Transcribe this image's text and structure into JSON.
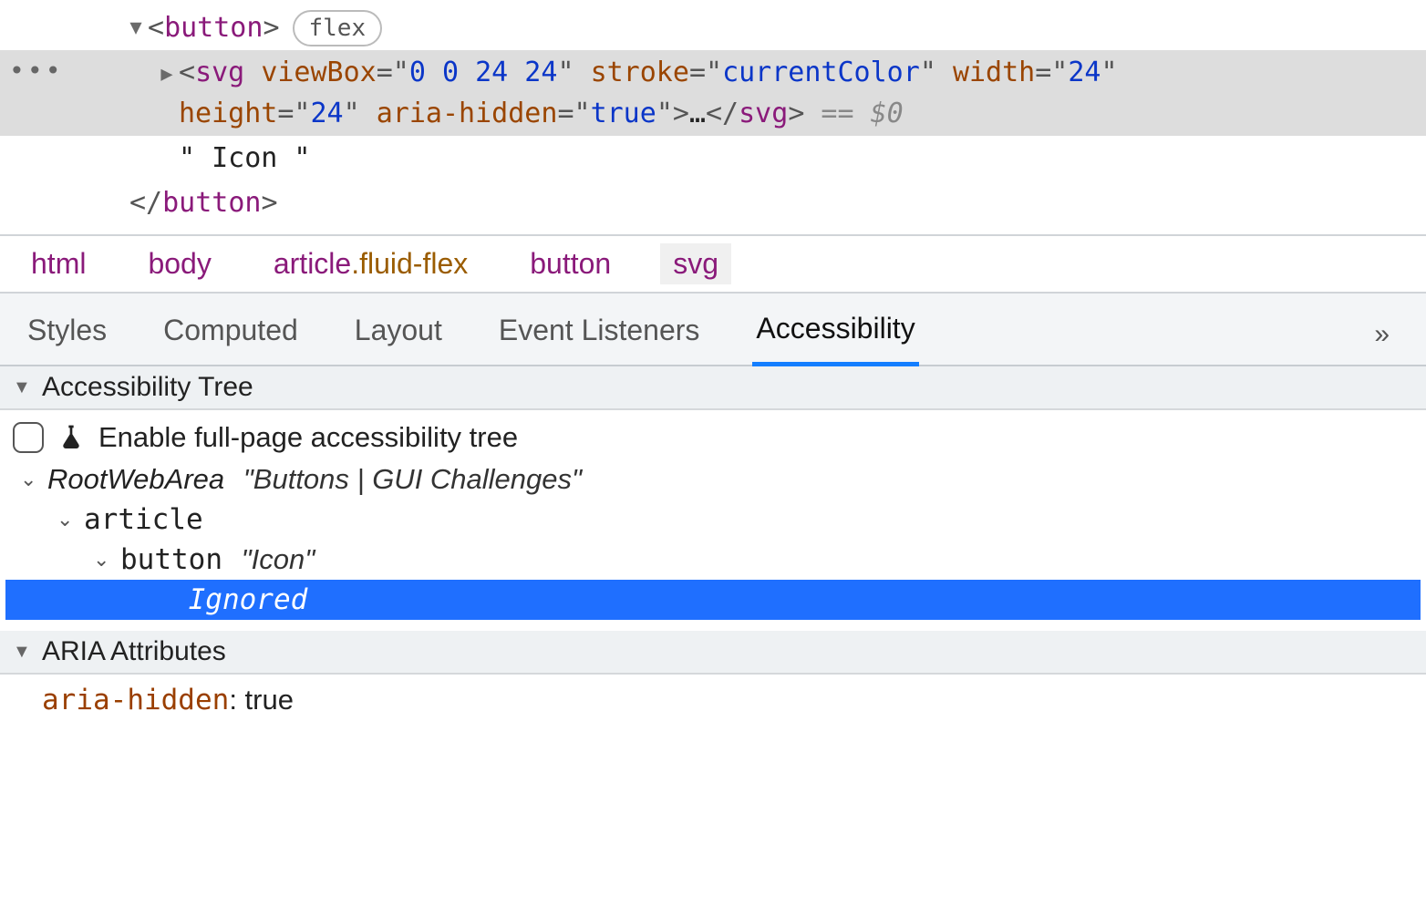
{
  "dom": {
    "button_open": "<button>",
    "button_close": "</button>",
    "flex_badge": "flex",
    "svg_tag": "svg",
    "svg_attrs": {
      "viewBox_name": "viewBox",
      "viewBox_val": "0 0 24 24",
      "stroke_name": "stroke",
      "stroke_val": "currentColor",
      "width_name": "width",
      "width_val": "24",
      "height_name": "height",
      "height_val": "24",
      "aria_hidden_name": "aria-hidden",
      "aria_hidden_val": "true"
    },
    "svg_collapsed_inner": "…",
    "selection_tail": " == $0",
    "text_node": "\" Icon \""
  },
  "breadcrumbs": {
    "html": "html",
    "body": "body",
    "article": "article",
    "article_class": ".fluid-flex",
    "button": "button",
    "svg": "svg"
  },
  "subtabs": {
    "styles": "Styles",
    "computed": "Computed",
    "layout": "Layout",
    "event_listeners": "Event Listeners",
    "accessibility": "Accessibility",
    "overflow": "»"
  },
  "a11y": {
    "section_tree": "Accessibility Tree",
    "enable_label": "Enable full-page accessibility tree",
    "root_role": "RootWebArea",
    "root_name": "\"Buttons | GUI Challenges\"",
    "article_role": "article",
    "button_role": "button",
    "button_name": "\"Icon\"",
    "ignored": "Ignored",
    "section_aria": "ARIA Attributes",
    "aria_attr_name": "aria-hidden",
    "aria_attr_sep": ": ",
    "aria_attr_value": "true"
  }
}
